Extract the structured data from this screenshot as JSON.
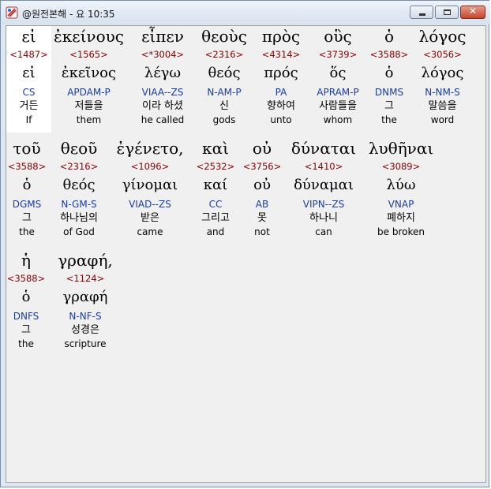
{
  "window": {
    "title": "@원전본해 - 요 10:35"
  },
  "lines": [
    [
      {
        "greek": "εἰ",
        "strong": "<1487>",
        "lemma": "εἰ",
        "parsing": "CS",
        "korean": "거든",
        "english": "If",
        "selected": true
      },
      {
        "greek": "ἐκείνους",
        "strong": "<1565>",
        "lemma": "ἐκεῖνος",
        "parsing": "APDAM-P",
        "korean": "저들을",
        "english": "them"
      },
      {
        "greek": "εἶπεν",
        "strong": "<*3004>",
        "lemma": "λέγω",
        "parsing": "VIAA--ZS",
        "korean": "이라 하셨",
        "english": "he called"
      },
      {
        "greek": "θεοὺς",
        "strong": "<2316>",
        "lemma": "θεός",
        "parsing": "N-AM-P",
        "korean": "신",
        "english": "gods"
      },
      {
        "greek": "πρὸς",
        "strong": "<4314>",
        "lemma": "πρός",
        "parsing": "PA",
        "korean": "향하여",
        "english": "unto"
      },
      {
        "greek": "οὓς",
        "strong": "<3739>",
        "lemma": "ὅς",
        "parsing": "APRAM-P",
        "korean": "사람들을",
        "english": "whom"
      },
      {
        "greek": "ὁ",
        "strong": "<3588>",
        "lemma": "ὁ",
        "parsing": "DNMS",
        "korean": "그",
        "english": "the"
      },
      {
        "greek": "λόγος",
        "strong": "<3056>",
        "lemma": "λόγος",
        "parsing": "N-NM-S",
        "korean": "말씀을",
        "english": "word"
      }
    ],
    [
      {
        "greek": "τοῦ",
        "strong": "<3588>",
        "lemma": "ὁ",
        "parsing": "DGMS",
        "korean": "그",
        "english": "the"
      },
      {
        "greek": "θεοῦ",
        "strong": "<2316>",
        "lemma": "θεός",
        "parsing": "N-GM-S",
        "korean": "하나님의",
        "english": "of God"
      },
      {
        "greek": "ἐγένετο,",
        "strong": "<1096>",
        "lemma": "γίνομαι",
        "parsing": "VIAD--ZS",
        "korean": "받은",
        "english": "came"
      },
      {
        "greek": "καὶ",
        "strong": "<2532>",
        "lemma": "καί",
        "parsing": "CC",
        "korean": "그리고",
        "english": "and"
      },
      {
        "greek": "οὐ",
        "strong": "<3756>",
        "lemma": "οὐ",
        "parsing": "AB",
        "korean": "못",
        "english": "not"
      },
      {
        "greek": "δύναται",
        "strong": "<1410>",
        "lemma": "δύναμαι",
        "parsing": "VIPN--ZS",
        "korean": "하나니",
        "english": "can"
      },
      {
        "greek": "λυθῆναι",
        "strong": "<3089>",
        "lemma": "λύω",
        "parsing": "VNAP",
        "korean": "폐하지",
        "english": "be broken"
      }
    ],
    [
      {
        "greek": "ἡ",
        "strong": "<3588>",
        "lemma": "ὁ",
        "parsing": "DNFS",
        "korean": "그",
        "english": "the"
      },
      {
        "greek": "γραφή,",
        "strong": "<1124>",
        "lemma": "γραφή",
        "parsing": "N-NF-S",
        "korean": "성경은",
        "english": "scripture"
      }
    ]
  ]
}
